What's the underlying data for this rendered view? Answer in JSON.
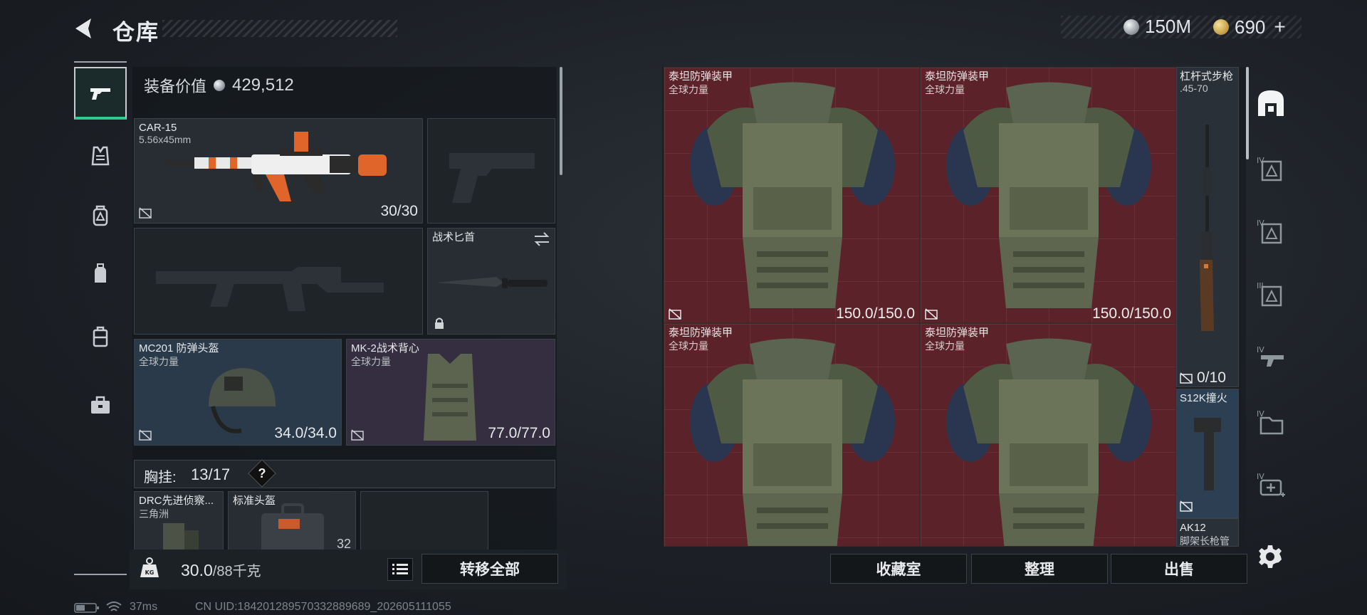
{
  "header": {
    "title": "仓库",
    "currency": [
      {
        "value": "150M",
        "icon": "silver-coin-icon"
      },
      {
        "value": "690",
        "icon": "gold-coin-icon",
        "plus": "+"
      }
    ]
  },
  "equipment": {
    "value_label": "装备价值",
    "value_amount": "429,512",
    "primary_weapon": {
      "name": "CAR-15",
      "caliber": "5.56x45mm",
      "ammo": "30/30"
    },
    "knife": {
      "name": "战术匕首"
    },
    "helmet": {
      "name": "MC201 防弹头盔",
      "faction": "全球力量",
      "durability": "34.0/34.0"
    },
    "vest": {
      "name": "MK-2战术背心",
      "faction": "全球力量",
      "durability": "77.0/77.0"
    },
    "chest_rig": {
      "label": "胸挂:",
      "count": "13/17",
      "help": "?"
    },
    "rig_items": [
      {
        "name": "DRC先进侦察...",
        "sub": "三角洲"
      },
      {
        "name": "标准头盔",
        "value": "32"
      }
    ],
    "weight": {
      "current": "30.0",
      "capacity": "/88千克"
    },
    "transfer_all": "转移全部"
  },
  "stash": {
    "armors": [
      {
        "name": "泰坦防弹装甲",
        "faction": "全球力量",
        "durability": "150.0/150.0"
      },
      {
        "name": "泰坦防弹装甲",
        "faction": "全球力量",
        "durability": "150.0/150.0"
      },
      {
        "name": "泰坦防弹装甲",
        "faction": "全球力量"
      },
      {
        "name": "泰坦防弹装甲",
        "faction": "全球力量"
      }
    ],
    "side_items": [
      {
        "name": "杠杆式步枪",
        "sub": ".45-70",
        "ammo": "0/10"
      },
      {
        "name": "S12K撞火"
      },
      {
        "name": "AK12",
        "sub": "脚架长枪管"
      }
    ],
    "buttons": {
      "collection": "收藏室",
      "sort": "整理",
      "sell": "出售"
    },
    "tier_labels": [
      "IV",
      "IV",
      "III",
      "IV",
      "IV",
      "IV"
    ]
  },
  "status": {
    "ping": "37ms",
    "uid": "CN UID:184201289570332889689_202605111055"
  },
  "colors": {
    "accent_green": "#2ecc8f",
    "armor_bg": "#5b2329",
    "helmet_bg": "#2a3a4a",
    "vest_bg": "#342e40"
  }
}
